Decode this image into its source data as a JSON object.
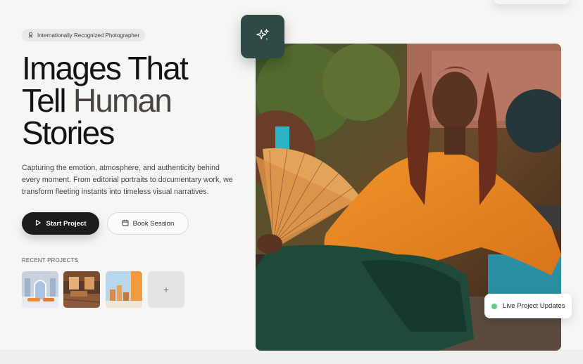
{
  "hero": {
    "badge": "Internationally Recognized Photographer",
    "headline": {
      "line1": "Images That",
      "line2_a": "Tell ",
      "line2_b": "Human",
      "line3": "Stories"
    },
    "description": "Capturing the emotion, atmosphere, and authenticity behind every moment. From editorial portraits to documentary work, we transform fleeting instants into timeless visual narratives.",
    "primary_button": "Start Project",
    "secondary_button": "Book Session"
  },
  "recent": {
    "label": "RECENT PROJECTS",
    "add_symbol": "+"
  },
  "status": {
    "live": "Live Project Updates"
  },
  "colors": {
    "accent_tile": "#2f4a46",
    "primary_button": "#1c1c1c",
    "live_dot": "#5fcf8a"
  },
  "icons": [
    "award-icon",
    "play-icon",
    "calendar-icon",
    "sparkles-icon",
    "plus-icon"
  ]
}
